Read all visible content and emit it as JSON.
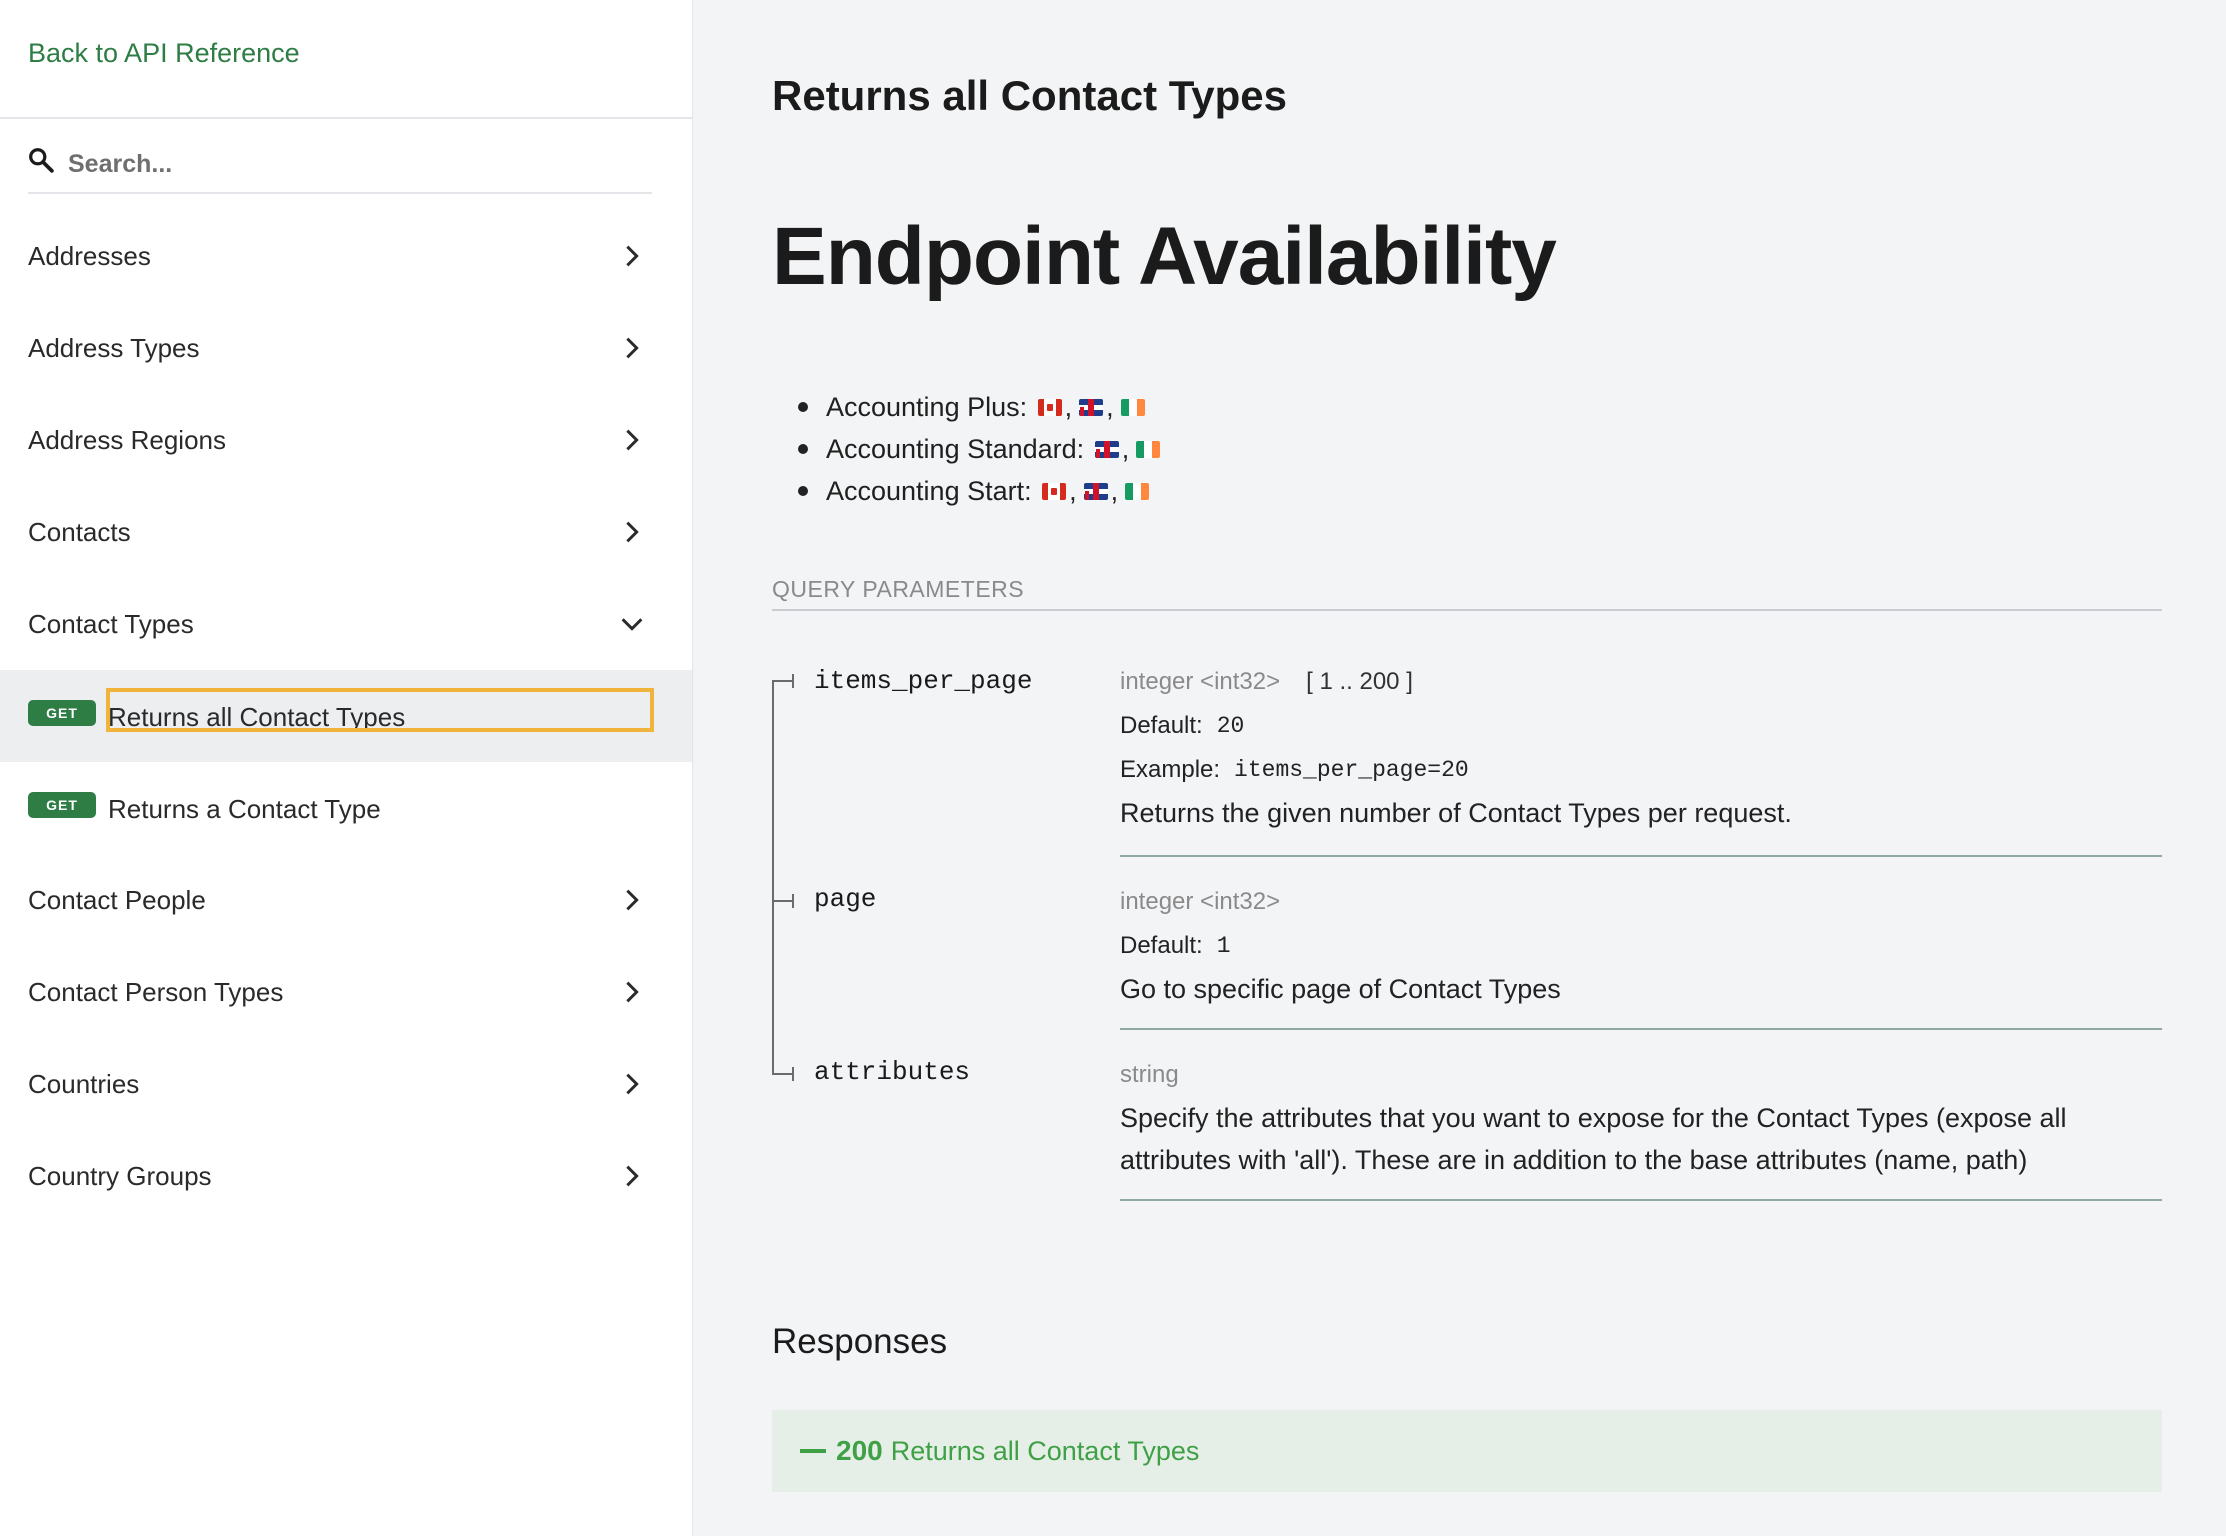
{
  "sidebar": {
    "back_link": "Back to API Reference",
    "search_placeholder": "Search...",
    "items": [
      {
        "label": "Addresses"
      },
      {
        "label": "Address Types"
      },
      {
        "label": "Address Regions"
      },
      {
        "label": "Contacts"
      },
      {
        "label": "Contact Types",
        "expanded": true
      },
      {
        "label": "Contact People"
      },
      {
        "label": "Contact Person Types"
      },
      {
        "label": "Countries"
      },
      {
        "label": "Country Groups"
      }
    ],
    "sub_items": [
      {
        "method": "GET",
        "label": "Returns all Contact Types",
        "active": true
      },
      {
        "method": "GET",
        "label": "Returns a Contact Type",
        "active": false
      }
    ]
  },
  "main": {
    "page_title": "Returns all Contact Types",
    "section_title": "Endpoint Availability",
    "availability": [
      {
        "label": "Accounting Plus:",
        "flags": [
          "ca",
          "gb",
          "ie"
        ]
      },
      {
        "label": "Accounting Standard:",
        "flags": [
          "gb",
          "ie"
        ]
      },
      {
        "label": "Accounting Start:",
        "flags": [
          "ca",
          "gb",
          "ie"
        ]
      }
    ],
    "query_params_header": "QUERY PARAMETERS",
    "params": [
      {
        "name": "items_per_page",
        "type": "integer <int32>",
        "range": "[ 1 .. 200 ]",
        "default_label": "Default:",
        "default_value": "20",
        "example_label": "Example:",
        "example_value": "items_per_page=20",
        "description": "Returns the given number of Contact Types per request."
      },
      {
        "name": "page",
        "type": "integer <int32>",
        "default_label": "Default:",
        "default_value": "1",
        "description": "Go to specific page of Contact Types"
      },
      {
        "name": "attributes",
        "type": "string",
        "description": "Specify the attributes that you want to expose for the Contact Types (expose all attributes with 'all'). These are in addition to the base attributes (name, path)"
      }
    ],
    "responses_title": "Responses",
    "response": {
      "code": "200",
      "label": "Returns all Contact Types"
    }
  },
  "colors": {
    "brand_green": "#2e7d45",
    "response_green": "#3fa046",
    "focus_outline": "#f0b33b"
  }
}
